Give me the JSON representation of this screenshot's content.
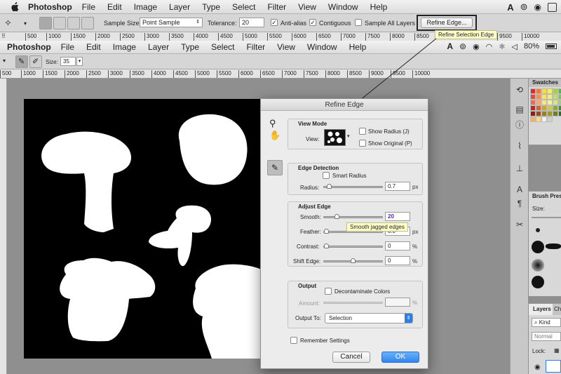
{
  "top_menubar": {
    "app": "Photoshop",
    "items": [
      "File",
      "Edit",
      "Image",
      "Layer",
      "Type",
      "Select",
      "Filter",
      "View",
      "Window",
      "Help"
    ]
  },
  "top_options": {
    "sample_size_label": "Sample Size:",
    "sample_size_value": "Point Sample",
    "tolerance_label": "Tolerance:",
    "tolerance_value": "20",
    "anti_alias": "Anti-alias",
    "contiguous": "Contiguous",
    "sample_all_layers": "Sample All Layers",
    "refine_edge_button": "Refine Edge...",
    "tooltip": "Refine Selection Edge"
  },
  "ruler_labels": [
    "500",
    "1000",
    "1500",
    "2000",
    "2500",
    "3000",
    "3500",
    "4000",
    "4500",
    "5000",
    "5500",
    "6000",
    "6500",
    "7000",
    "7500",
    "8000",
    "8500",
    "9000",
    "9500",
    "10000"
  ],
  "second_menubar": {
    "app": "Photoshop",
    "items": [
      "File",
      "Edit",
      "Image",
      "Layer",
      "Type",
      "Select",
      "Filter",
      "View",
      "Window",
      "Help"
    ],
    "battery": "80%"
  },
  "brush_options": {
    "size_label": "Size:",
    "size_value": "35"
  },
  "panels": {
    "swatches_title": "Swatches",
    "brush_presets_title": "Brush Prese",
    "brush_size_label": "Size:",
    "layers_tab": "Layers",
    "channels_tab": "Ch",
    "kind_label": "Kind",
    "blend_mode": "Normal",
    "lock_label": "Lock:",
    "swatch_colors": [
      "#e8262a",
      "#f47a2a",
      "#fbe12a",
      "#f9f24a",
      "#a9d13a",
      "#4cb848",
      "#e84a3a",
      "#f6914a",
      "#fde35a",
      "#eef07a",
      "#c2de62",
      "#7cc366",
      "#f06a5a",
      "#f8a76a",
      "#fde680",
      "#f2f3a0",
      "#d4e68a",
      "#9ccf8a",
      "#b52a2a",
      "#c96a2a",
      "#c9a92a",
      "#c9c94a",
      "#8ca93a",
      "#3c8a3a",
      "#8a1f1f",
      "#9a4a1f",
      "#9a7f1f",
      "#9a9a2a",
      "#6a7f2a",
      "#2a6a2a",
      "#f6b060",
      "#fadc80",
      "#f0f0f0",
      "#d0d0d0"
    ]
  },
  "dialog": {
    "title": "Refine Edge",
    "view_mode": {
      "title": "View Mode",
      "view_label": "View:",
      "show_radius": "Show Radius (J)",
      "show_original": "Show Original (P)"
    },
    "edge_detection": {
      "title": "Edge Detection",
      "smart_radius": "Smart Radius",
      "radius_label": "Radius:",
      "radius_value": "0.7",
      "radius_unit": "px",
      "radius_level": 0.05
    },
    "adjust_edge": {
      "title": "Adjust Edge",
      "smooth_label": "Smooth:",
      "smooth_value": "20",
      "smooth_level": 0.2,
      "feather_label": "Feather:",
      "feather_value": "0.0",
      "feather_unit": "px",
      "feather_level": 0,
      "contrast_label": "Contrast:",
      "contrast_value": "0",
      "contrast_unit": "%",
      "contrast_level": 0,
      "shift_label": "Shift Edge:",
      "shift_value": "0",
      "shift_unit": "%",
      "shift_level": 0.5,
      "tooltip": "Smooth jagged edges"
    },
    "output": {
      "title": "Output",
      "decontaminate": "Decontaminate Colors",
      "amount_label": "Amount:",
      "amount_unit": "%",
      "output_to_label": "Output To:",
      "output_to_value": "Selection"
    },
    "remember_settings": "Remember Settings",
    "cancel": "Cancel",
    "ok": "OK"
  }
}
